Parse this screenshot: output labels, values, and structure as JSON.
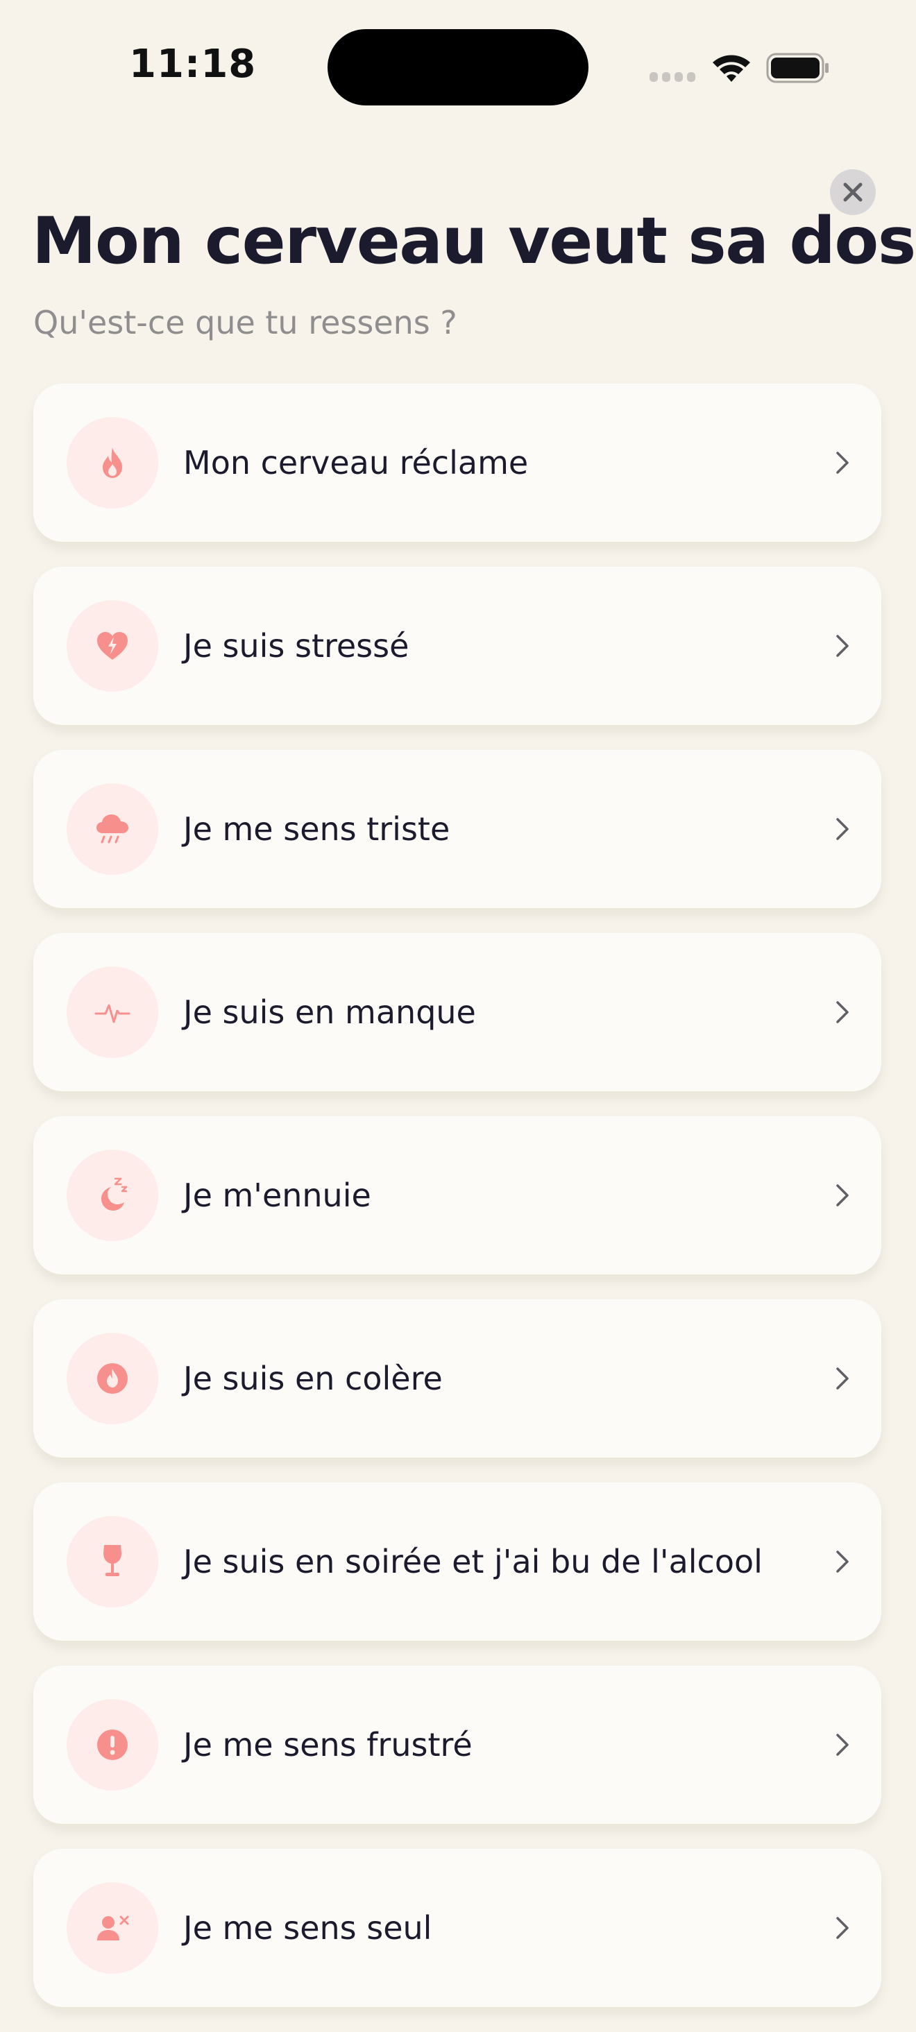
{
  "status_bar": {
    "time": "11:18"
  },
  "header": {
    "title": "Mon cerveau veut sa dose",
    "subtitle": "Qu'est-ce que tu ressens ?"
  },
  "colors": {
    "background": "#f7f3eb",
    "card": "#fdfbf7",
    "icon_circle": "#fdecea",
    "icon_accent": "#f7908c",
    "title_text": "#1c1b2e",
    "subtitle_text": "#8f8d8d"
  },
  "moods": [
    {
      "label": "Mon cerveau réclame",
      "icon": "flame-icon"
    },
    {
      "label": "Je suis stressé",
      "icon": "heart-bolt-icon"
    },
    {
      "label": "Je me sens triste",
      "icon": "rain-cloud-icon"
    },
    {
      "label": "Je suis en manque",
      "icon": "pulse-icon"
    },
    {
      "label": "Je m'ennuie",
      "icon": "moon-sleep-icon"
    },
    {
      "label": "Je suis en colère",
      "icon": "angry-flame-icon"
    },
    {
      "label": "Je suis en soirée et j'ai bu de l'alcool",
      "icon": "wine-glass-icon"
    },
    {
      "label": "Je me sens frustré",
      "icon": "exclamation-icon"
    },
    {
      "label": "Je me sens seul",
      "icon": "person-x-icon"
    }
  ]
}
